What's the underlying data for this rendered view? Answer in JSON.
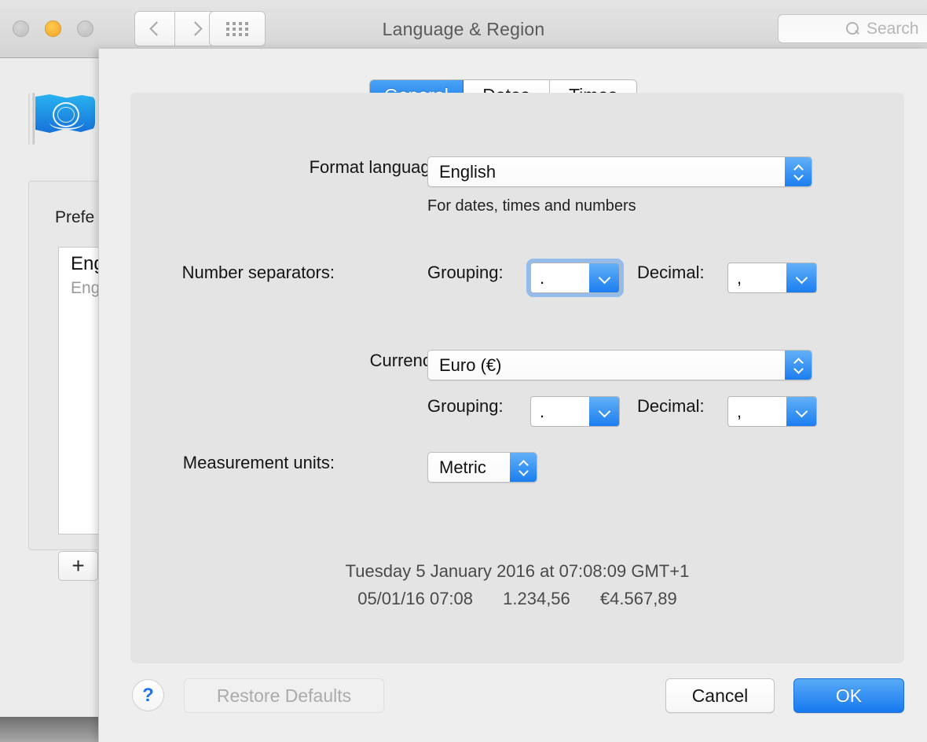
{
  "window": {
    "title": "Language & Region",
    "traffic_lights": [
      "close",
      "minimize",
      "zoom"
    ],
    "back_icon": "chevron-left-icon",
    "forward_icon": "chevron-right-icon",
    "grid_icon": "show-all-grid-icon",
    "search": {
      "placeholder": "Search",
      "icon": "search-icon"
    }
  },
  "background": {
    "flag_icon": "un-flag-icon",
    "preferred_languages_label": "Prefe",
    "language_primary": "Eng",
    "language_secondary": "Eng",
    "add_button_label": "+"
  },
  "sheet": {
    "tabs": [
      {
        "label": "General",
        "selected": true
      },
      {
        "label": "Dates",
        "selected": false
      },
      {
        "label": "Times",
        "selected": false
      }
    ],
    "format_language": {
      "label": "Format language:",
      "value": "English",
      "hint": "For dates, times and numbers"
    },
    "number_separators": {
      "label": "Number separators:",
      "grouping_label": "Grouping:",
      "grouping_value": ".",
      "grouping_focused": true,
      "decimal_label": "Decimal:",
      "decimal_value": ","
    },
    "currency": {
      "label": "Currency:",
      "value": "Euro (€)",
      "grouping_label": "Grouping:",
      "grouping_value": ".",
      "decimal_label": "Decimal:",
      "decimal_value": ","
    },
    "measurement_units": {
      "label": "Measurement units:",
      "value": "Metric"
    },
    "preview": {
      "line1": "Tuesday 5 January 2016 at 07:08:09 GMT+1",
      "date_short": "05/01/16 07:08",
      "number_sample": "1.234,56",
      "currency_sample": "€4.567,89"
    },
    "footer": {
      "help_label": "?",
      "restore_defaults_label": "Restore Defaults",
      "cancel_label": "Cancel",
      "ok_label": "OK"
    }
  },
  "colors": {
    "accent_blue": "#1779f0",
    "tab_selected": "#2a8cf2",
    "focus_ring": "#7eb2eb",
    "window_bg": "#ececec",
    "sheet_bg": "#eeeeee",
    "panel_bg": "#e4e4e4"
  }
}
